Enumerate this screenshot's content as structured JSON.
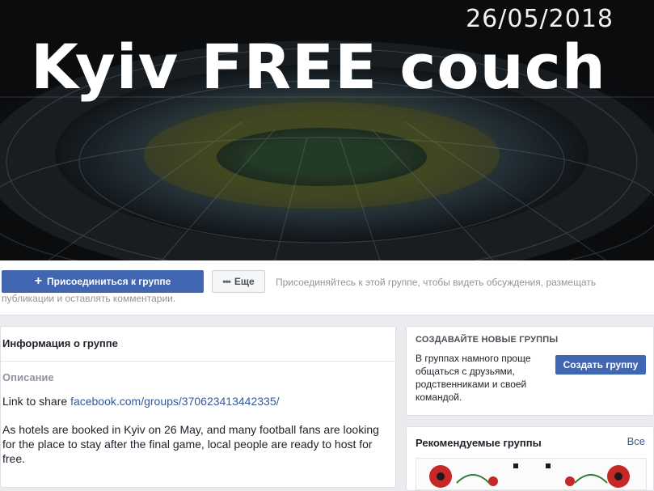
{
  "cover": {
    "date": "26/05/2018",
    "title": "Kyiv FREE couch"
  },
  "actions": {
    "join_label": "Присоединиться к группе",
    "more_label": "Еще",
    "join_hint": "Присоединяйтесь к этой группе, чтобы видеть обсуждения, размещать публикации и оставлять комментарии."
  },
  "info": {
    "header": "Информация о группе",
    "description_title": "Описание",
    "link_prefix": "Link to share ",
    "link_text": "facebook.com/groups/370623413442335/",
    "description": "As hotels are booked in Kyiv on 26 May, and many football fans are looking for the place to stay after the final game, local people are ready to host for free."
  },
  "create_groups": {
    "title": "СОЗДАВАЙТЕ НОВЫЕ ГРУППЫ",
    "text": "В группах намного проще общаться с друзьями, родственниками и своей командой.",
    "button_label": "Создать группу"
  },
  "recommended": {
    "title": "Рекомендуемые группы",
    "see_all": "Все"
  },
  "colors": {
    "primary": "#4267b2",
    "link": "#365899",
    "background": "#e9ebee"
  }
}
